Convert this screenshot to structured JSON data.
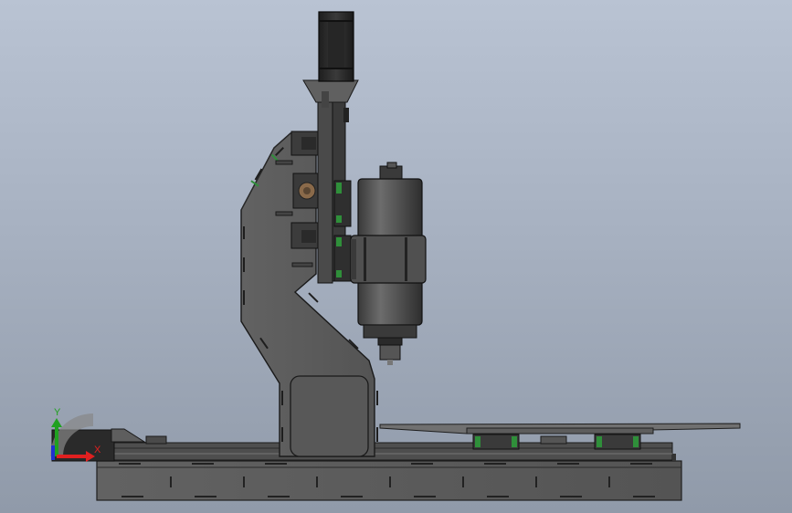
{
  "viewport": {
    "background_top": "#b9c3d3",
    "background_bottom": "#909aa9"
  },
  "model": {
    "body_color": "#5a5a5a",
    "body_dark": "#3c3c3c",
    "edge_color": "#1e1e1e",
    "rail_green": "#2f8f3a",
    "spindle_color": "#4a4a4a",
    "motor_color": "#2b2b2b",
    "bed_color": "#6a6a6a"
  },
  "triad": {
    "x_label": "X",
    "y_label": "Y",
    "x_color": "#e02020",
    "y_color": "#20a020",
    "z_color": "#2030d0"
  }
}
